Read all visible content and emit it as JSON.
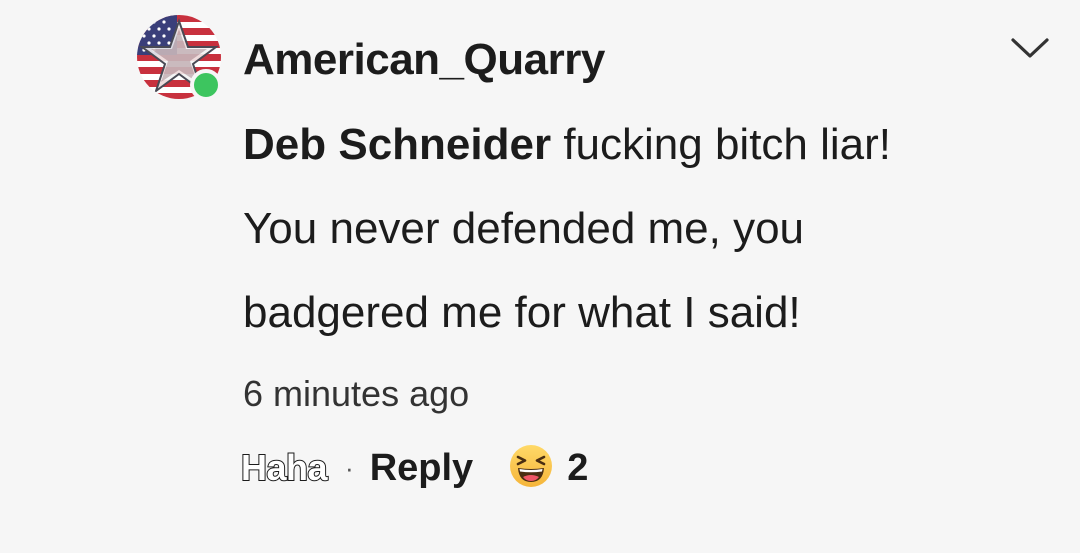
{
  "comment": {
    "author": "American_Quarry",
    "mention": "Deb Schneider",
    "text": " fucking bitch liar! You never defended me, you badgered me for what I said!",
    "timestamp": "6 minutes ago",
    "actions": {
      "react_label": "Haha",
      "separator": "·",
      "reply_label": "Reply"
    },
    "reactions": {
      "icon": "laughing-face-icon",
      "count": "2"
    },
    "avatar_icon": "american-flag-star-icon",
    "online_status_color": "#3dc55f",
    "menu_icon": "chevron-down-icon"
  }
}
